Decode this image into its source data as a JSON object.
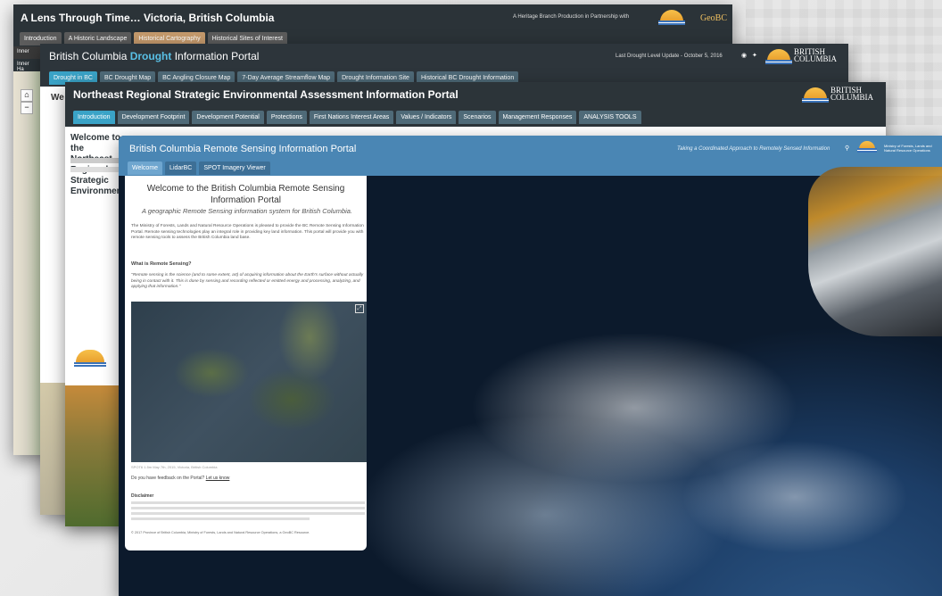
{
  "w1": {
    "title": "A Lens Through Time… Victoria, British Columbia",
    "partner": "A Heritage Branch Production in Partnership with",
    "geobc": "GeoBC",
    "tabs": [
      "Introduction",
      "A Historic Landscape",
      "Historical Cartography",
      "Historical Sites of Interest"
    ],
    "inner_tab": "Inner",
    "inner_label": "Inner Ha"
  },
  "w2": {
    "title_pre": "British Columbia",
    "title_accent": "Drought",
    "title_post": "Information Portal",
    "update": "Last Drought Level Update - October 5, 2016",
    "tabs": [
      "Drought in BC",
      "BC Drought Map",
      "BC Angling Closure Map",
      "7-Day Average Streamflow Map",
      "Drought Information Site",
      "Historical BC Drought Information"
    ],
    "welcome": "We"
  },
  "w3": {
    "title": "Northeast Regional Strategic Environmental Assessment Information Portal",
    "tabs": [
      "Introduction",
      "Development Footprint",
      "Development Potential",
      "Protections",
      "First Nations Interest Areas",
      "Values / Indicators",
      "Scenarios",
      "Management Responses",
      "ANALYSIS TOOLS"
    ],
    "heading": "Welcome to the Northeast Regional Strategic Environmen"
  },
  "w4": {
    "title": "British Columbia Remote Sensing Information Portal",
    "tagline": "Taking a Coordinated Approach to Remotely Sensed Information",
    "tabs": [
      "Welcome",
      "LidarBC",
      "SPOT Imagery Viewer"
    ],
    "ministry": "Ministry of Forests, Lands and Natural Resource Operations",
    "heading": "Welcome to the British Columbia Remote Sensing Information Portal",
    "subheading": "A geographic Remote Sensing information system for British Columbia.",
    "intro": "The Ministry of Forests, Lands and Natural Resource Operations is pleased to provide the BC Remote Sensing Information Portal. Remote sensing technologies play an integral role in providing key land information. This portal will provide you with remote sensing tools to assess the British Columbia land base.",
    "what_heading": "What is Remote Sensing?",
    "quote": "\"Remote sensing is the science (and to some extent, art) of acquiring information about the Earth's surface without actually being in contact with it. This is done by sensing and recording reflected or emitted energy and processing, analyzing, and applying that information.\"",
    "caption": "SPOT6 1.5m May 7th, 2015, Victoria, British Columbia",
    "feedback_pre": "Do you have feedback on the Portal?",
    "feedback_link": "Let us know",
    "disclaimer_heading": "Disclaimer",
    "footer": "© 2017 Province of British Columbia, Ministry of Forests, Lands and Natural Resource Operations, a GeoBC Resource."
  },
  "bc": {
    "line1": "BRITISH",
    "line2": "COLUMBIA"
  }
}
